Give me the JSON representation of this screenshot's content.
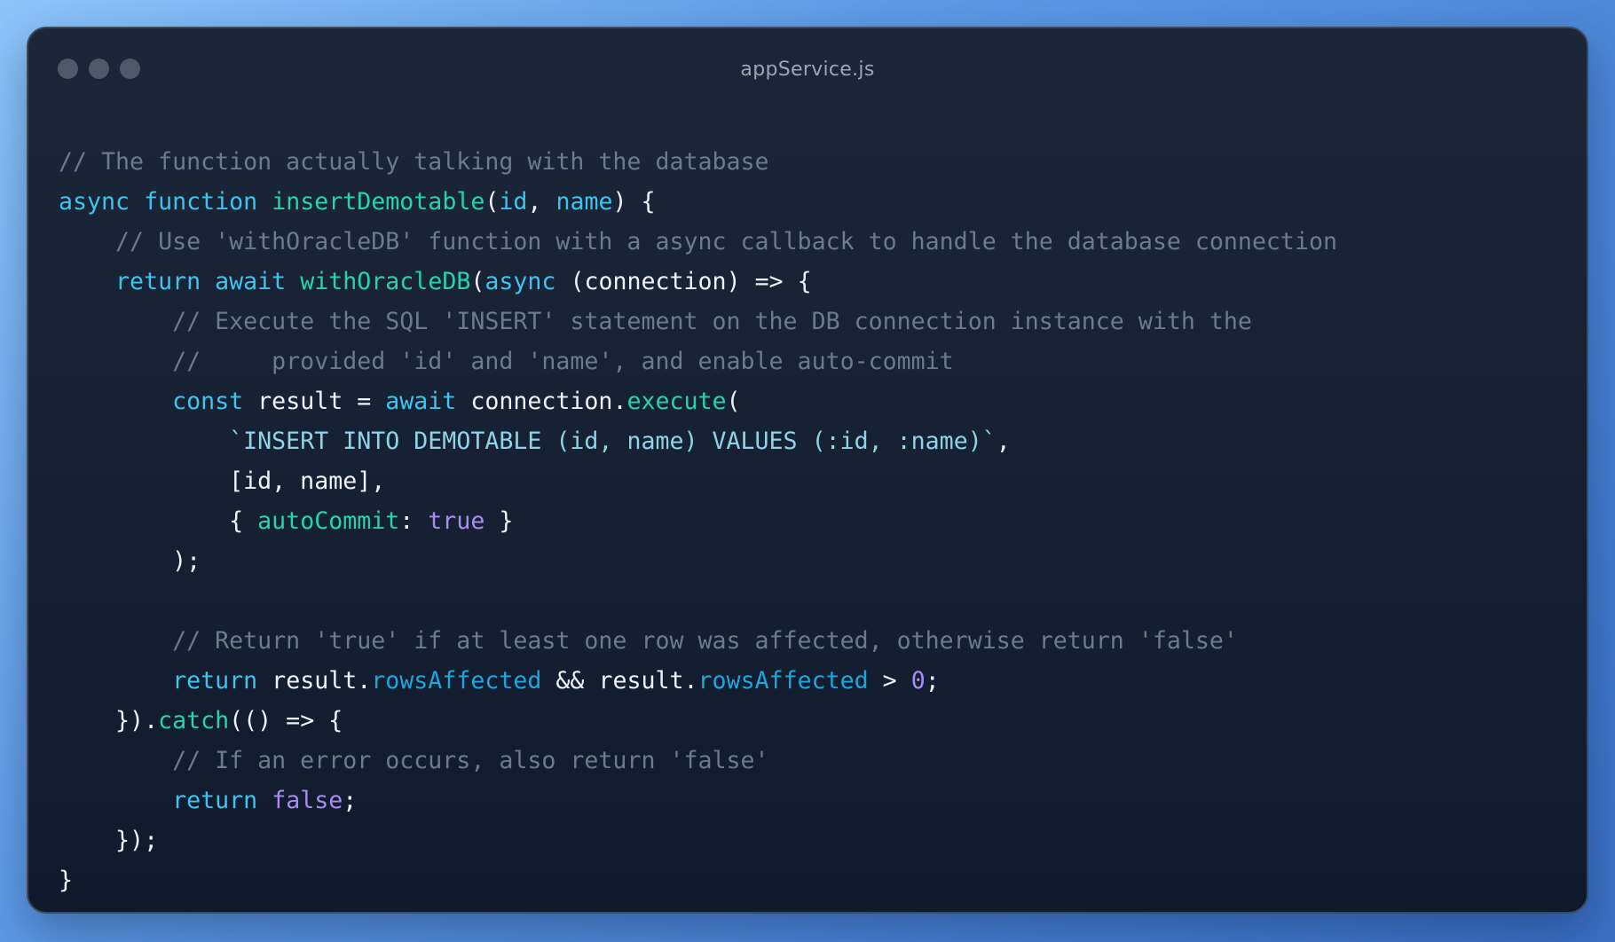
{
  "window": {
    "title": "appService.js"
  },
  "colors": {
    "comment": "#6b7a8c",
    "keyword": "#3cc4ee",
    "function": "#27d1b4",
    "plain": "#eef2f8",
    "string": "#8ed3e8",
    "property": "#1ea6dc",
    "literal": "#a88cf0"
  },
  "code": {
    "lines": [
      [
        {
          "t": "// The function actually talking with the database",
          "c": "cm"
        }
      ],
      [
        {
          "t": "async",
          "c": "kw"
        },
        {
          "t": " ",
          "c": "pl"
        },
        {
          "t": "function",
          "c": "kw"
        },
        {
          "t": " ",
          "c": "pl"
        },
        {
          "t": "insertDemotable",
          "c": "fn"
        },
        {
          "t": "(",
          "c": "pl"
        },
        {
          "t": "id",
          "c": "pm"
        },
        {
          "t": ", ",
          "c": "pl"
        },
        {
          "t": "name",
          "c": "pm"
        },
        {
          "t": ") {",
          "c": "pl"
        }
      ],
      [
        {
          "t": "    // Use 'withOracleDB' function with a async callback to handle the database connection",
          "c": "cm"
        }
      ],
      [
        {
          "t": "    ",
          "c": "pl"
        },
        {
          "t": "return",
          "c": "kw"
        },
        {
          "t": " ",
          "c": "pl"
        },
        {
          "t": "await",
          "c": "kw"
        },
        {
          "t": " ",
          "c": "pl"
        },
        {
          "t": "withOracleDB",
          "c": "fn"
        },
        {
          "t": "(",
          "c": "pl"
        },
        {
          "t": "async",
          "c": "kw"
        },
        {
          "t": " (connection) => {",
          "c": "pl"
        }
      ],
      [
        {
          "t": "        // Execute the SQL 'INSERT' statement on the DB connection instance with the",
          "c": "cm"
        }
      ],
      [
        {
          "t": "        //     provided 'id' and 'name', and enable auto-commit",
          "c": "cm"
        }
      ],
      [
        {
          "t": "        ",
          "c": "pl"
        },
        {
          "t": "const",
          "c": "kw"
        },
        {
          "t": " result = ",
          "c": "pl"
        },
        {
          "t": "await",
          "c": "kw"
        },
        {
          "t": " connection.",
          "c": "pl"
        },
        {
          "t": "execute",
          "c": "fn"
        },
        {
          "t": "(",
          "c": "pl"
        }
      ],
      [
        {
          "t": "            ",
          "c": "pl"
        },
        {
          "t": "`INSERT INTO DEMOTABLE (id, name) VALUES (:id, :name)`",
          "c": "str"
        },
        {
          "t": ",",
          "c": "pl"
        }
      ],
      [
        {
          "t": "            [id, name],",
          "c": "pl"
        }
      ],
      [
        {
          "t": "            { ",
          "c": "pl"
        },
        {
          "t": "autoCommit",
          "c": "fn"
        },
        {
          "t": ": ",
          "c": "pl"
        },
        {
          "t": "true",
          "c": "lit"
        },
        {
          "t": " }",
          "c": "pl"
        }
      ],
      [
        {
          "t": "        );",
          "c": "pl"
        }
      ],
      [],
      [
        {
          "t": "        // Return 'true' if at least one row was affected, otherwise return 'false'",
          "c": "cm"
        }
      ],
      [
        {
          "t": "        ",
          "c": "pl"
        },
        {
          "t": "return",
          "c": "kw"
        },
        {
          "t": " result.",
          "c": "pl"
        },
        {
          "t": "rowsAffected",
          "c": "prop"
        },
        {
          "t": " && result.",
          "c": "pl"
        },
        {
          "t": "rowsAffected",
          "c": "prop"
        },
        {
          "t": " > ",
          "c": "pl"
        },
        {
          "t": "0",
          "c": "lit"
        },
        {
          "t": ";",
          "c": "pl"
        }
      ],
      [
        {
          "t": "    }).",
          "c": "pl"
        },
        {
          "t": "catch",
          "c": "fn"
        },
        {
          "t": "(() => {",
          "c": "pl"
        }
      ],
      [
        {
          "t": "        // If an error occurs, also return 'false'",
          "c": "cm"
        }
      ],
      [
        {
          "t": "        ",
          "c": "pl"
        },
        {
          "t": "return",
          "c": "kw"
        },
        {
          "t": " ",
          "c": "pl"
        },
        {
          "t": "false",
          "c": "lit"
        },
        {
          "t": ";",
          "c": "pl"
        }
      ],
      [
        {
          "t": "    });",
          "c": "pl"
        }
      ],
      [
        {
          "t": "}",
          "c": "pl"
        }
      ]
    ]
  }
}
